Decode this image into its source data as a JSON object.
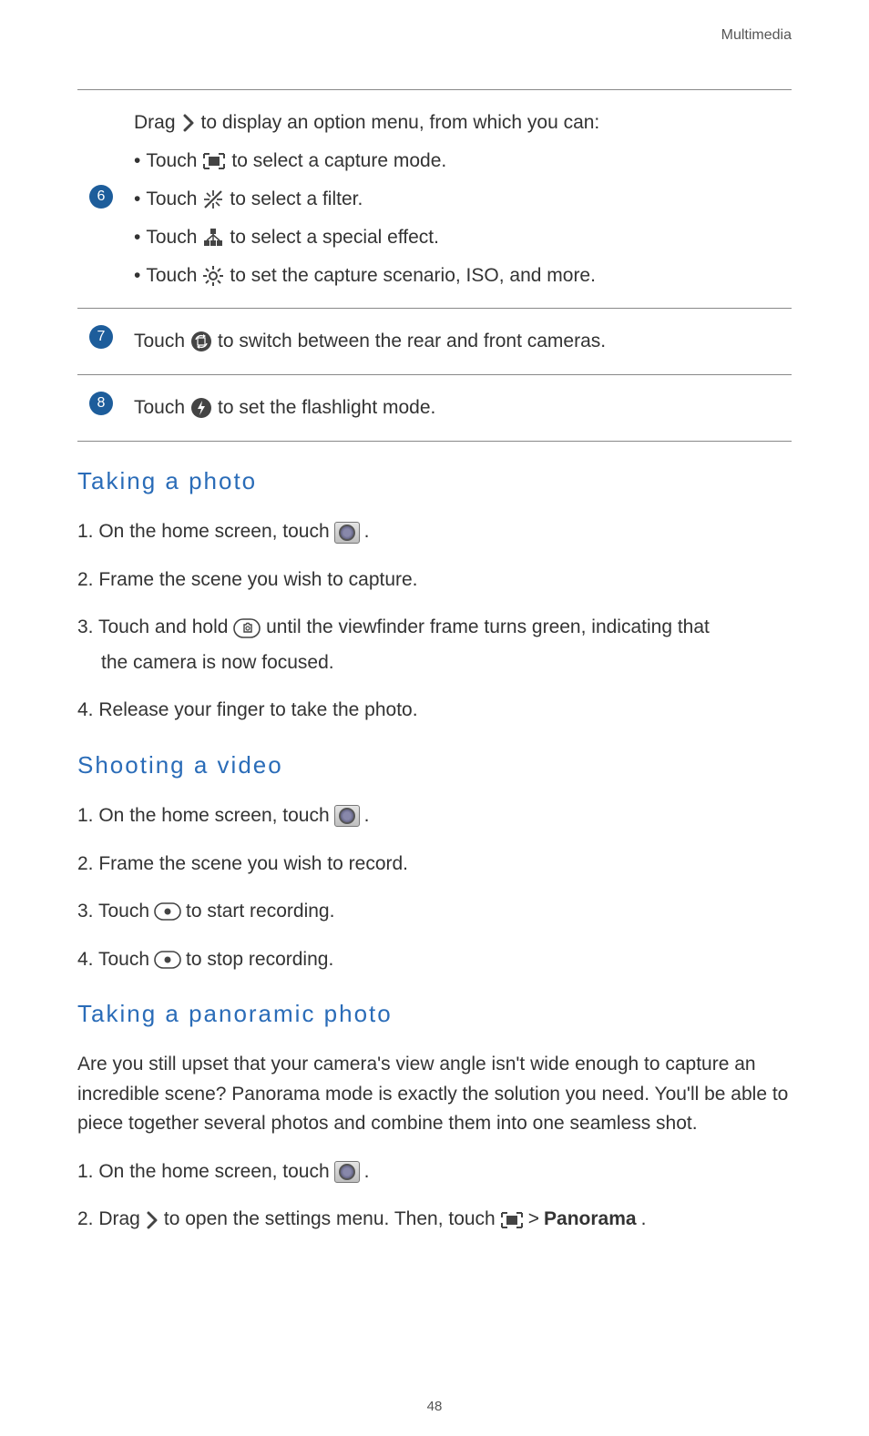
{
  "header": "Multimedia",
  "table": {
    "row6": {
      "badge": "6",
      "line1_a": "Drag",
      "line1_b": "to display an option menu, from which you can:",
      "bullet_prefix": "•",
      "b1_a": "Touch",
      "b1_b": "to select a capture mode.",
      "b2_a": "Touch",
      "b2_b": "to select a filter.",
      "b3_a": "Touch",
      "b3_b": "to select a special effect.",
      "b4_a": "Touch",
      "b4_b": "to set the capture scenario, ISO, and more."
    },
    "row7": {
      "badge": "7",
      "a": "Touch",
      "b": "to switch between the rear and front cameras."
    },
    "row8": {
      "badge": "8",
      "a": "Touch",
      "b": "to set the flashlight mode."
    }
  },
  "sections": {
    "photo": {
      "heading": "Taking  a  photo",
      "s1_a": "1. On the home screen, touch",
      "s1_b": ".",
      "s2": "2. Frame the scene you wish to capture.",
      "s3_a": "3. Touch and hold",
      "s3_b": "until the viewfinder frame turns green, indicating that",
      "s3_c": "the camera is now focused.",
      "s4": "4. Release your finger to take the photo."
    },
    "video": {
      "heading": "Shooting  a  video",
      "s1_a": "1. On the home screen, touch",
      "s1_b": ".",
      "s2": "2. Frame the scene you wish to record.",
      "s3_a": "3. Touch",
      "s3_b": "to start recording.",
      "s4_a": "4. Touch",
      "s4_b": "to stop recording."
    },
    "pano": {
      "heading": "Taking  a  panoramic  photo",
      "intro": "Are you still upset that your camera's view angle isn't wide enough to capture an incredible scene? Panorama mode is exactly the solution you need. You'll be able to piece together several photos and combine them into one seamless shot.",
      "s1_a": "1. On the home screen, touch",
      "s1_b": ".",
      "s2_a": "2. Drag",
      "s2_b": "to open the settings menu. Then, touch",
      "s2_c": ">",
      "s2_d": "Panorama",
      "s2_e": "."
    }
  },
  "page_number": "48"
}
